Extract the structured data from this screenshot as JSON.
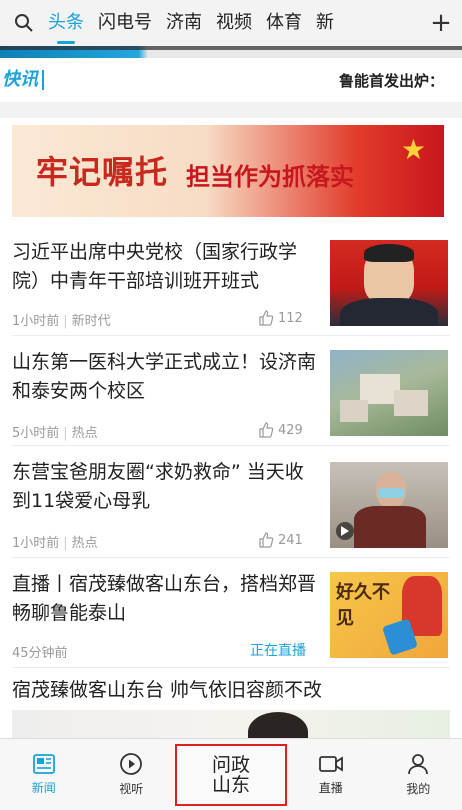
{
  "top_tabs": [
    "头条",
    "闪电号",
    "济南",
    "视频",
    "体育",
    "新"
  ],
  "flash": {
    "label": "快讯",
    "headline": "鲁能首发出炉："
  },
  "banner": {
    "calligraphy": "牢记嘱托",
    "slogan": "担当作为抓落实"
  },
  "news": [
    {
      "title": "习近平出席中央党校（国家行政学院）中青年干部培训班开班式",
      "time": "1小时前",
      "source": "新时代",
      "likes": "112"
    },
    {
      "title": "山东第一医科大学正式成立！设济南和泰安两个校区",
      "time": "5小时前",
      "source": "热点",
      "likes": "429"
    },
    {
      "title": "东营宝爸朋友圈“求奶救命” 当天收到11袋爱心母乳",
      "time": "1小时前",
      "source": "热点",
      "likes": "241"
    },
    {
      "title": "直播丨宿茂臻做客山东台，搭档郑晋畅聊鲁能泰山",
      "time": "45分钟前",
      "status": "正在直播",
      "thumb_text": "好久不见"
    },
    {
      "title": "宿茂臻做客山东台 帅气依旧容颜不改"
    }
  ],
  "bottom_nav": {
    "news": "新闻",
    "video": "视听",
    "center_line1": "问政",
    "center_line2": "山东",
    "live": "直播",
    "me": "我的"
  },
  "colors": {
    "accent": "#1aa3d9",
    "highlight_border": "#e02020"
  }
}
